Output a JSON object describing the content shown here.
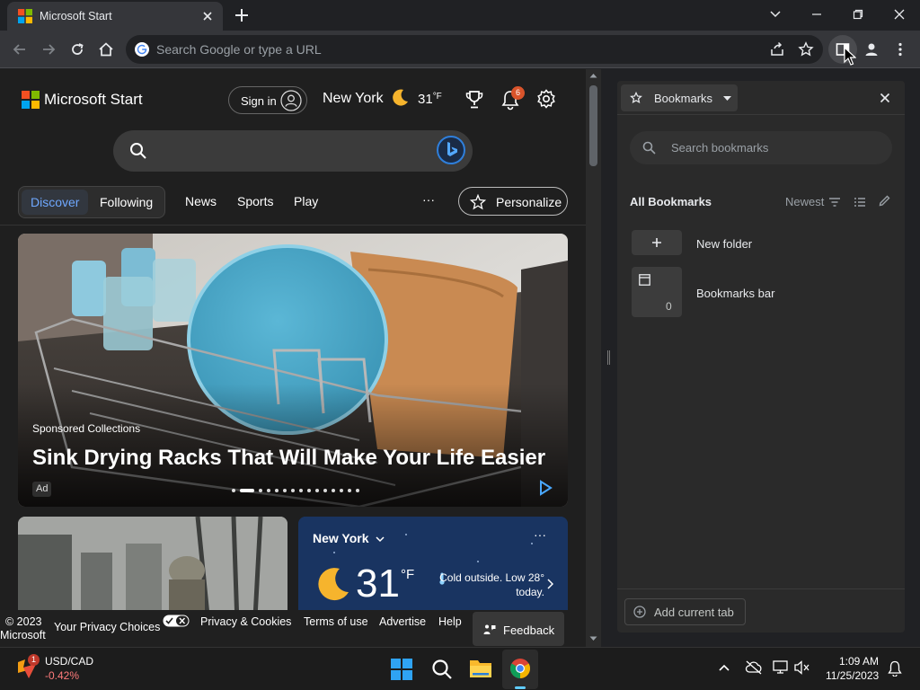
{
  "browser": {
    "tab_title": "Microsoft Start",
    "omnibox_placeholder": "Search Google or type a URL"
  },
  "msn": {
    "brand": "Microsoft Start",
    "sign_in": "Sign in",
    "city": "New York",
    "temperature": "31",
    "temperature_unit": "°F",
    "notification_count": "6",
    "nav": {
      "discover": "Discover",
      "following": "Following",
      "news": "News",
      "sports": "Sports",
      "play": "Play",
      "more": "···",
      "personalize": "Personalize"
    },
    "hero": {
      "sponsor": "Sponsored Collections",
      "title": "Sink Drying Racks That Will Make Your Life Easier",
      "ad_badge": "Ad",
      "slide_count": 15,
      "active_slide": 2
    },
    "weather_card": {
      "city": "New York",
      "temp": "31",
      "unit": "°F",
      "desc": "Cold outside. Low 28° today.",
      "more": "···"
    },
    "footer": {
      "copyright_line1": "© 2023",
      "copyright_line2": "Microsoft",
      "privacy_choices": "Your Privacy Choices",
      "privacy_cookies": "Privacy & Cookies",
      "terms": "Terms of use",
      "advertise": "Advertise",
      "help": "Help",
      "feedback": "Feedback"
    }
  },
  "bookmarks_panel": {
    "title": "Bookmarks",
    "search_placeholder": "Search bookmarks",
    "section_title": "All Bookmarks",
    "sort": "Newest",
    "items": [
      {
        "label": "New folder"
      },
      {
        "label": "Bookmarks bar",
        "count": "0"
      }
    ],
    "add_current_tab": "Add current tab"
  },
  "taskbar": {
    "ticker_symbol": "USD/CAD",
    "ticker_change": "-0.42%",
    "ticker_badge": "1",
    "time": "1:09 AM",
    "date": "11/25/2023"
  },
  "colors": {
    "chrome_bg": "#202124",
    "toolbar_bg": "#35363a",
    "negative": "#ff7b7b",
    "weather_card_bg": "#173057"
  }
}
